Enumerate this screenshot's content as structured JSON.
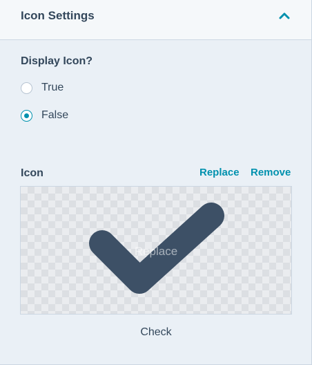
{
  "header": {
    "title": "Icon Settings",
    "toggle_icon": "chevron-up-icon"
  },
  "display_icon": {
    "label": "Display Icon?",
    "options": [
      {
        "label": "True",
        "selected": false
      },
      {
        "label": "False",
        "selected": true
      }
    ]
  },
  "icon_field": {
    "label": "Icon",
    "replace_label": "Replace",
    "remove_label": "Remove",
    "preview_watermark": "Replace",
    "preview_icon": "check-icon",
    "icon_name": "Check"
  },
  "colors": {
    "accent": "#0091ae",
    "text": "#33475b",
    "icon_fill": "#3d5066",
    "background": "#eaf0f6"
  }
}
